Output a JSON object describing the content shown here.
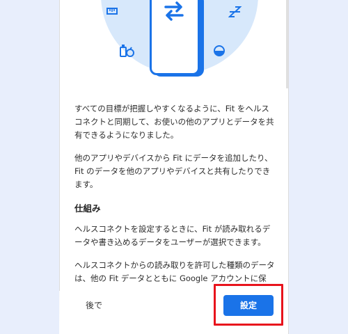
{
  "body": {
    "paragraph1": "すべての目標が把握しやすくなるように、Fit をヘルスコネクトと同期して、お使いの他のアプリとデータを共有できるようになりました。",
    "paragraph2": "他のアプリやデバイスから Fit にデータを追加したり、Fit のデータを他のアプリやデバイスと共有したりできます。",
    "heading": "仕組み",
    "paragraph3": "ヘルスコネクトを設定するときに、Fit が読み取れるデータや書き込めるデータをユーザーが選択できます。",
    "paragraph4": "ヘルスコネクトからの読み取りを許可した種類のデータは、他の Fit データとともに Google アカウントに保"
  },
  "actions": {
    "later_label": "後で",
    "setup_label": "設定"
  },
  "colors": {
    "accent": "#1a73e8",
    "highlight": "#e8131c",
    "hero_bg": "#d7e8fb",
    "page_bg": "#e8eefc"
  },
  "icons": [
    "ruler-icon",
    "sleep-zzz-icon",
    "nutrition-icon",
    "water-drop-icon",
    "sync-arrows-icon"
  ]
}
